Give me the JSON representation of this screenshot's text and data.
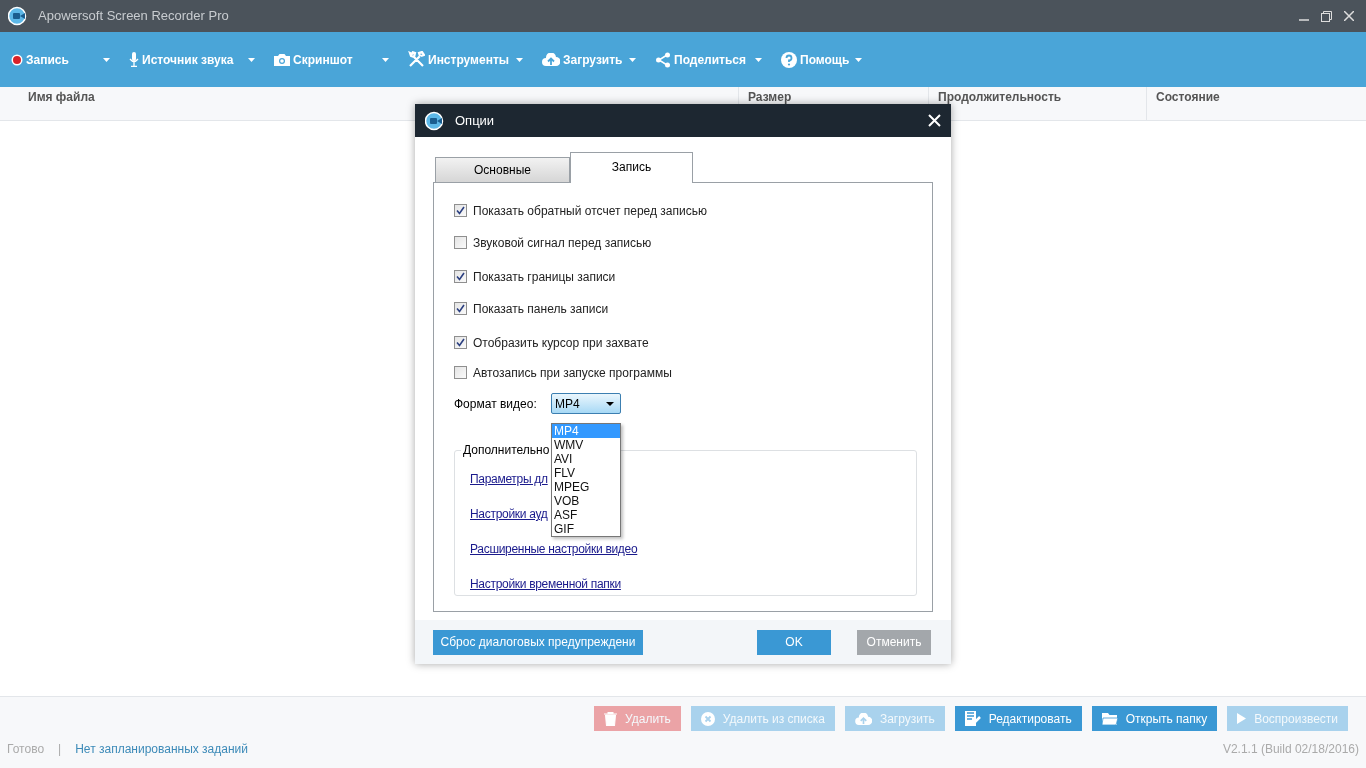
{
  "window": {
    "title": "Apowersoft Screen Recorder Pro"
  },
  "toolbar": [
    {
      "label": "Запись"
    },
    {
      "label": "Источник звука"
    },
    {
      "label": "Скриншот"
    },
    {
      "label": "Инструменты"
    },
    {
      "label": "Загрузить"
    },
    {
      "label": "Поделиться"
    },
    {
      "label": "Помощь"
    }
  ],
  "table": {
    "columns": [
      "Имя файла",
      "Размер",
      "Продолжительность",
      "Состояние"
    ]
  },
  "dialog": {
    "title": "Опции",
    "tabs": [
      {
        "label": "Основные",
        "selected": false
      },
      {
        "label": "Запись",
        "selected": true
      }
    ],
    "checkboxes": [
      {
        "label": "Показать обратный отсчет перед записью",
        "checked": true
      },
      {
        "label": "Звуковой сигнал перед записью",
        "checked": false
      },
      {
        "label": "Показать границы записи",
        "checked": true
      },
      {
        "label": "Показать панель записи",
        "checked": true
      },
      {
        "label": "Отобразить курсор при захвате",
        "checked": true
      },
      {
        "label": "Автозапись при запуске программы",
        "checked": false
      }
    ],
    "format": {
      "label": "Формат видео:",
      "value": "MP4",
      "expanded": true,
      "options": [
        {
          "label": "MP4",
          "selected": true
        },
        {
          "label": "WMV",
          "selected": false
        },
        {
          "label": "AVI",
          "selected": false
        },
        {
          "label": "FLV",
          "selected": false
        },
        {
          "label": "MPEG",
          "selected": false
        },
        {
          "label": "VOB",
          "selected": false
        },
        {
          "label": "ASF",
          "selected": false
        },
        {
          "label": "GIF",
          "selected": false
        }
      ]
    },
    "group": {
      "title": "Дополнительно",
      "links": [
        "Параметры  дл",
        "Настройки ауд",
        "Расширенные настройки видео",
        "Настройки временной папки"
      ]
    },
    "buttons": [
      {
        "label": "Сброс диалоговых предупреждени",
        "disabled": false
      },
      {
        "label": "OK",
        "disabled": false
      },
      {
        "label": "Отменить",
        "disabled": true
      }
    ]
  },
  "actions": [
    {
      "label": "Удалить",
      "disabled": true,
      "kind": "danger"
    },
    {
      "label": "Удалить из списка",
      "disabled": true,
      "kind": "normal"
    },
    {
      "label": "Загрузить",
      "disabled": true,
      "kind": "normal"
    },
    {
      "label": "Редактировать",
      "disabled": false,
      "kind": "normal"
    },
    {
      "label": "Открыть папку",
      "disabled": false,
      "kind": "normal"
    },
    {
      "label": "Воспроизвести",
      "disabled": true,
      "kind": "normal"
    }
  ],
  "status_bar": {
    "state": "Готово",
    "separator": "|",
    "schedule": "Нет запланированных заданий",
    "version": "V2.1.1 (Build 02/18/2016)"
  }
}
